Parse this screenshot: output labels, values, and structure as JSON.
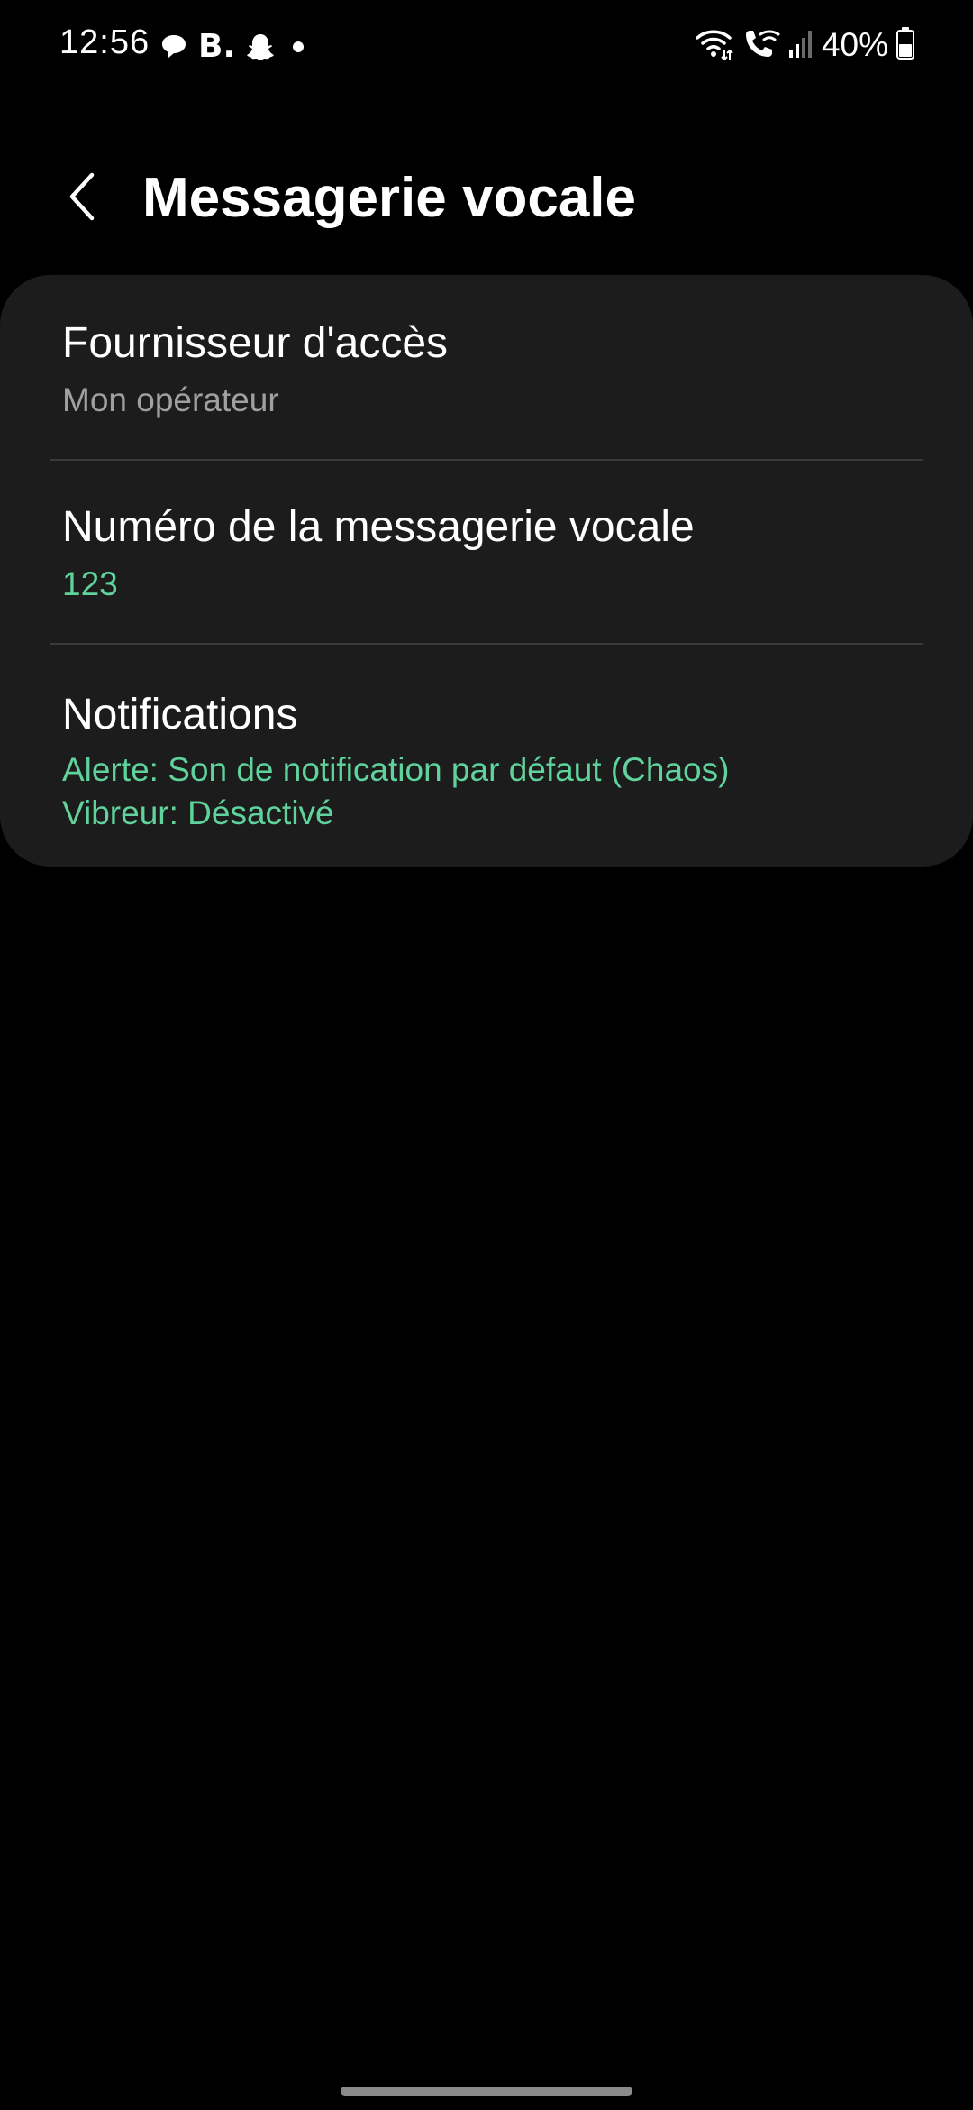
{
  "status_bar": {
    "time": "12:56",
    "brand_letter": "B.",
    "battery_percent": "40%",
    "left_icons": [
      "chat-bubble-icon",
      "b-logo-icon",
      "snapchat-ghost-icon",
      "dot-icon"
    ],
    "right_icons": [
      "wifi-icon",
      "wifi-calling-icon",
      "signal-icon",
      "battery-icon"
    ]
  },
  "header": {
    "title": "Messagerie vocale",
    "back_icon": "chevron-left-icon"
  },
  "settings": {
    "items": [
      {
        "title": "Fournisseur d'accès",
        "subtitle": "Mon opérateur"
      },
      {
        "title": "Numéro de la messagerie vocale",
        "subtitle": "123"
      },
      {
        "title": "Notifications",
        "subtitle_alert": "Alerte: Son de notification par défaut (Chaos)",
        "subtitle_vibrate": "Vibreur: Désactivé"
      }
    ]
  },
  "colors": {
    "background": "#000000",
    "card": "#1c1c1c",
    "accent_green": "#5fd39b",
    "secondary_text": "#a0a0a0",
    "divider": "#3a3a3a"
  }
}
